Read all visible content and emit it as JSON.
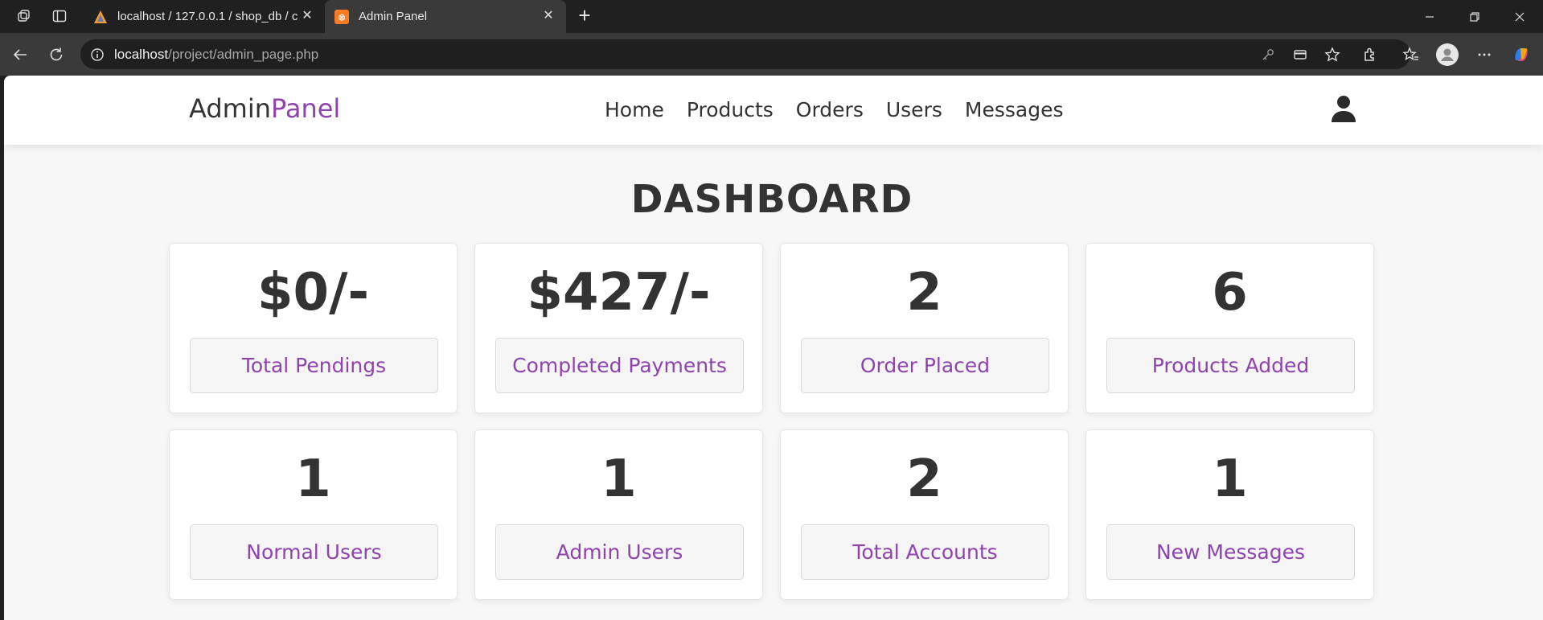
{
  "browser": {
    "tabs": [
      {
        "title": "localhost / 127.0.0.1 / shop_db / c",
        "active": false,
        "favicon": "phpmyadmin-icon"
      },
      {
        "title": "Admin Panel",
        "active": true,
        "favicon": "xampp-icon"
      }
    ],
    "url": {
      "host": "localhost",
      "path": "/project/admin_page.php"
    }
  },
  "header": {
    "logo": {
      "main": "Admin",
      "accent": "Panel"
    },
    "nav": [
      {
        "label": "Home"
      },
      {
        "label": "Products"
      },
      {
        "label": "Orders"
      },
      {
        "label": "Users"
      },
      {
        "label": "Messages"
      }
    ]
  },
  "dashboard": {
    "title": "DASHBOARD",
    "cards": [
      {
        "value": "$0/-",
        "label": "Total Pendings"
      },
      {
        "value": "$427/-",
        "label": "Completed Payments"
      },
      {
        "value": "2",
        "label": "Order Placed"
      },
      {
        "value": "6",
        "label": "Products Added"
      },
      {
        "value": "1",
        "label": "Normal Users"
      },
      {
        "value": "1",
        "label": "Admin Users"
      },
      {
        "value": "2",
        "label": "Total Accounts"
      },
      {
        "value": "1",
        "label": "New Messages"
      }
    ]
  },
  "colors": {
    "accent": "#8e44ad",
    "text": "#333333",
    "page_bg": "#f7f7f7"
  }
}
